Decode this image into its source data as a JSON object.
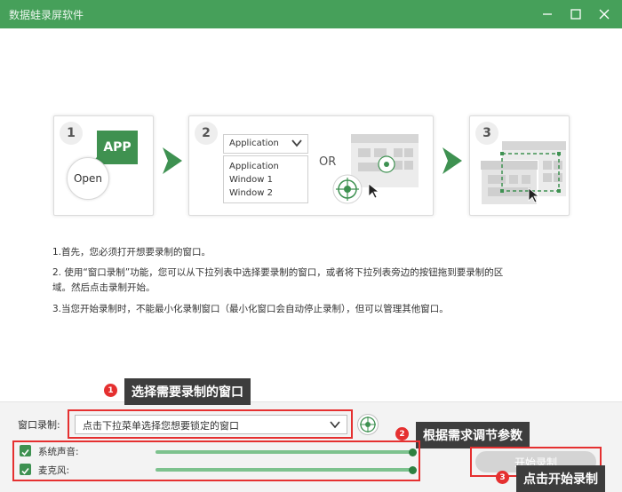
{
  "window": {
    "title": "数据蛙录屏软件",
    "minimize_label": "minimize",
    "maximize_label": "maximize",
    "close_label": "close"
  },
  "steps": [
    {
      "number": "1",
      "app_label": "APP",
      "open_label": "Open"
    },
    {
      "number": "2",
      "dropdown_header": "Application",
      "dropdown_items": [
        "Application",
        "Window 1",
        "Window 2"
      ],
      "or_label": "OR"
    },
    {
      "number": "3"
    }
  ],
  "instructions": {
    "line1": "1.首先，您必须打开想要录制的窗口。",
    "line2a": "2. 使用“窗口录制”功能，您可以从下拉列表中选择要录制的窗口，或者将下拉列表旁边的按钮拖到要录制的区",
    "line2b": "域。然后点击录制开始。",
    "line3": "3.当您开始录制时，不能最小化录制窗口（最小化窗口会自动停止录制），但可以管理其他窗口。"
  },
  "controls": {
    "window_record_label": "窗口录制:",
    "window_select_placeholder": "点击下拉菜单选择您想要锁定的窗口",
    "system_audio_label": "系统声音:",
    "system_audio_checked": true,
    "system_audio_level": 1.0,
    "microphone_label": "麦克风:",
    "microphone_checked": true,
    "microphone_level": 1.0,
    "start_button_label": "开始录制"
  },
  "annotations": [
    {
      "number": "1",
      "text": "选择需要录制的窗口"
    },
    {
      "number": "2",
      "text": "根据需求调节参数"
    },
    {
      "number": "3",
      "text": "点击开始录制"
    }
  ],
  "colors": {
    "brand_green": "#46a05a",
    "check_green": "#3e9151",
    "slider_green": "#7dc28e",
    "annotation_red": "#e53030",
    "callout_bg": "#3d3d3d"
  }
}
